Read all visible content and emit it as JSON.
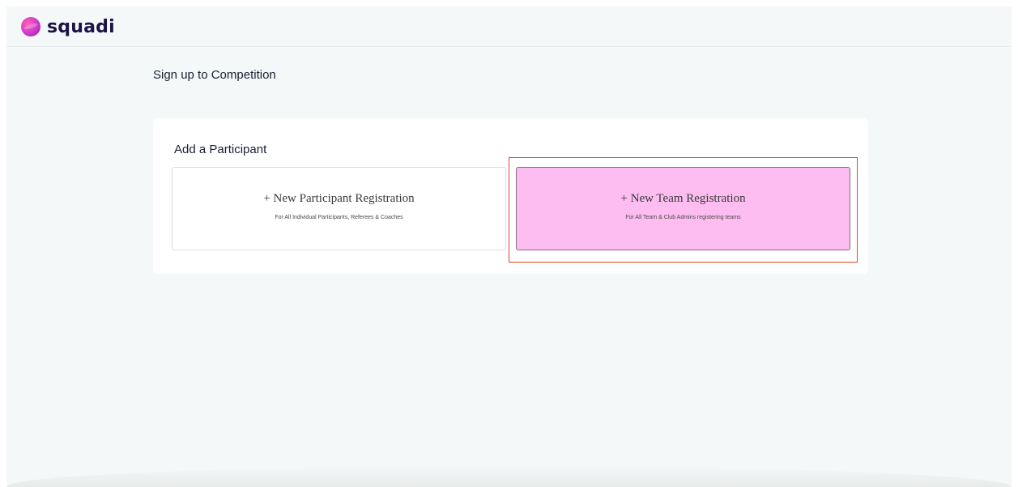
{
  "brand": {
    "name": "squadi",
    "icon": "squadi-logo-icon",
    "accent": "#d93fcf"
  },
  "page": {
    "title": "Sign up to Competition"
  },
  "participant_card": {
    "title": "Add a Participant",
    "options": [
      {
        "label": "+ New Participant Registration",
        "subtitle": "For All Individual Participants, Referees & Coaches"
      },
      {
        "label": "+ New Team Registration",
        "subtitle": "For All Team & Club Admins registering teams",
        "highlight_color": "#fdbdf0"
      }
    ]
  },
  "annotation": {
    "outline_color": "#e0452a"
  }
}
